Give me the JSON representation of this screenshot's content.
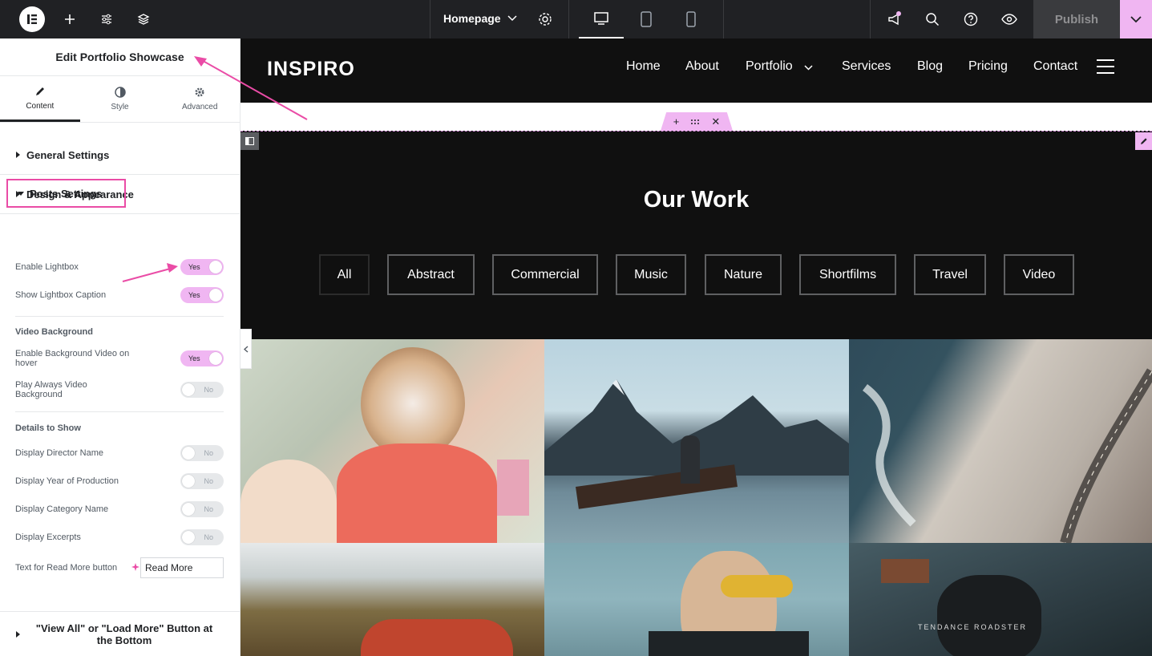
{
  "topbar": {
    "page_selector": "Homepage",
    "publish_label": "Publish"
  },
  "panel": {
    "title": "Edit Portfolio Showcase",
    "tabs": [
      {
        "label": "Content",
        "icon": "pencil-icon"
      },
      {
        "label": "Style",
        "icon": "half-circle-icon"
      },
      {
        "label": "Advanced",
        "icon": "gear-icon"
      }
    ],
    "sections": {
      "general": "General Settings",
      "design": "Design & Appearance",
      "posts": "Posts Settings",
      "bottom": "\"View All\" or \"Load More\" Button at the Bottom"
    },
    "controls": {
      "enable_lightbox": {
        "label": "Enable Lightbox",
        "value": "Yes"
      },
      "show_caption": {
        "label": "Show Lightbox Caption",
        "value": "Yes"
      },
      "video_bg_heading": "Video Background",
      "enable_bg_video": {
        "label": "Enable Background Video on hover",
        "value": "Yes"
      },
      "play_always": {
        "label": "Play Always Video Background",
        "value": "No"
      },
      "details_heading": "Details to Show",
      "director": {
        "label": "Display Director Name",
        "value": "No"
      },
      "year": {
        "label": "Display Year of Production",
        "value": "No"
      },
      "category": {
        "label": "Display Category Name",
        "value": "No"
      },
      "excerpts": {
        "label": "Display Excerpts",
        "value": "No"
      },
      "read_more": {
        "label": "Text for Read More button",
        "value": "Read More"
      }
    }
  },
  "site": {
    "brand": "INSPIRO",
    "nav": [
      "Home",
      "About",
      "Portfolio",
      "Services",
      "Blog",
      "Pricing",
      "Contact"
    ],
    "heading": "Our Work",
    "filters": [
      "All",
      "Abstract",
      "Commercial",
      "Music",
      "Nature",
      "Shortfilms",
      "Travel",
      "Video"
    ],
    "watermark": "TENDANCE ROADSTER"
  },
  "colors": {
    "accent_pink": "#f0b6f2",
    "annotation": "#ea4ca6",
    "topbar": "#202124",
    "site_dark": "#101010"
  }
}
